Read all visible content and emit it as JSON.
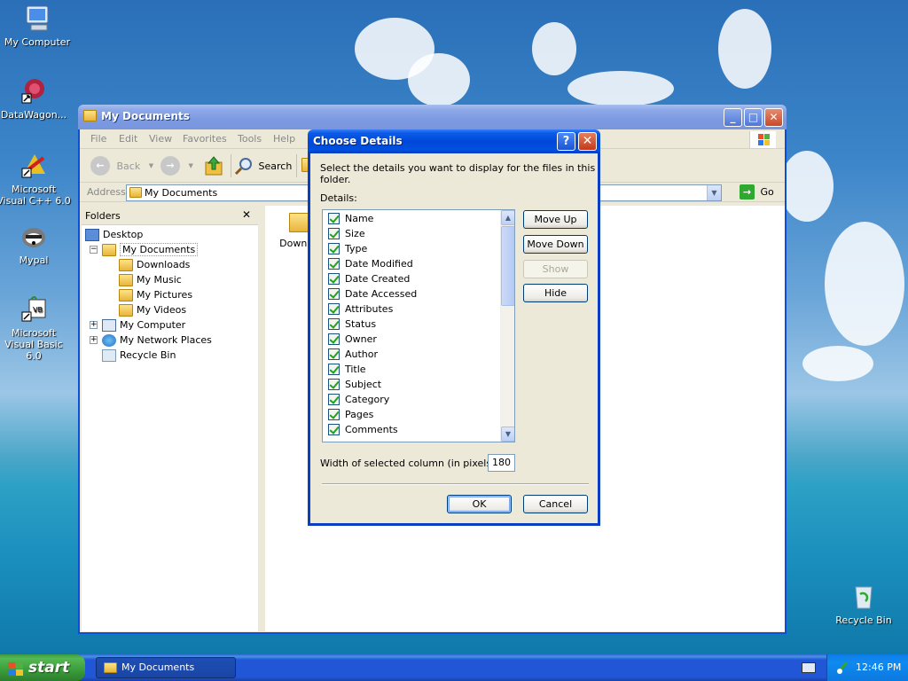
{
  "desktop": {
    "icons": [
      {
        "label": "My Computer"
      },
      {
        "label": "DataWagon..."
      },
      {
        "label": "Microsoft Visual C++ 6.0"
      },
      {
        "label": "Mypal"
      },
      {
        "label": "Microsoft Visual Basic 6.0"
      },
      {
        "label": "Recycle Bin"
      }
    ]
  },
  "explorer": {
    "title": "My Documents",
    "menu": [
      "File",
      "Edit",
      "View",
      "Favorites",
      "Tools",
      "Help"
    ],
    "toolbar": {
      "back": "Back",
      "search": "Search"
    },
    "address": {
      "label": "Address",
      "value": "My Documents",
      "go": "Go"
    },
    "folders": {
      "header": "Folders",
      "tree": [
        "Desktop",
        "My Documents",
        "Downloads",
        "My Music",
        "My Pictures",
        "My Videos",
        "My Computer",
        "My Network Places",
        "Recycle Bin"
      ]
    },
    "content": {
      "items": [
        "Downloa"
      ]
    }
  },
  "dialog": {
    "title": "Choose Details",
    "help": "?",
    "close": "✕",
    "description": "Select the details you want to display for the files in this folder.",
    "details_label": "Details:",
    "details": [
      "Name",
      "Size",
      "Type",
      "Date Modified",
      "Date Created",
      "Date Accessed",
      "Attributes",
      "Status",
      "Owner",
      "Author",
      "Title",
      "Subject",
      "Category",
      "Pages",
      "Comments"
    ],
    "buttons": {
      "move_up": "Move Up",
      "move_down": "Move Down",
      "show": "Show",
      "hide": "Hide",
      "ok": "OK",
      "cancel": "Cancel"
    },
    "width_label": "Width of selected column (in pixels):",
    "width_value": "180"
  },
  "taskbar": {
    "start": "start",
    "task": "My Documents",
    "clock": "12:46 PM"
  },
  "colors": {
    "xp_blue": "#0a4fd6",
    "start_green": "#3a9c3a",
    "dialog_face": "#ece9d8"
  }
}
